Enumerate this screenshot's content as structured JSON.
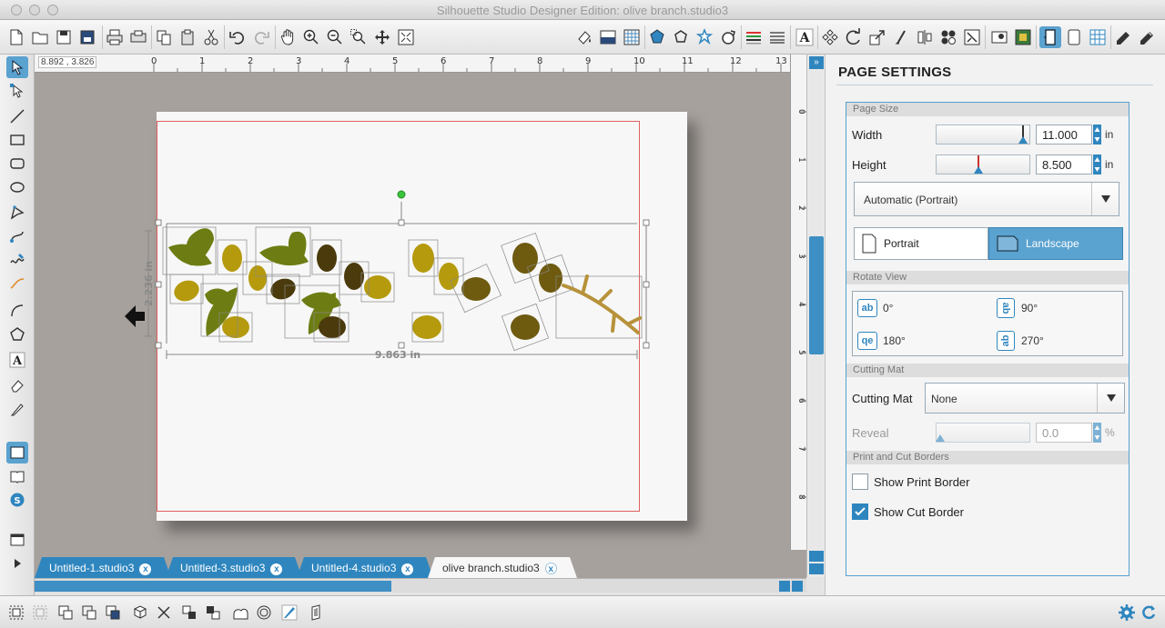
{
  "window": {
    "title": "Silhouette Studio Designer Edition: olive branch.studio3"
  },
  "canvas": {
    "coord_readout": "8.892 , 3.826",
    "ruler_top_labels": [
      "0",
      "1",
      "2",
      "3",
      "4",
      "5",
      "6",
      "7",
      "8",
      "9",
      "10",
      "11",
      "12",
      "13"
    ],
    "ruler_side_labels": [
      "0",
      "1",
      "2",
      "3",
      "4",
      "5",
      "6",
      "7",
      "8"
    ],
    "dim_width": "9.863 in",
    "dim_height": "2.236 in"
  },
  "tabs": [
    {
      "label": "Untitled-1.studio3",
      "close": "x"
    },
    {
      "label": "Untitled-3.studio3",
      "close": "x"
    },
    {
      "label": "Untitled-4.studio3",
      "close": "x"
    },
    {
      "label": "olive branch.studio3",
      "close": "x"
    }
  ],
  "panel": {
    "title": "PAGE SETTINGS",
    "page_size": {
      "header": "Page Size",
      "width_label": "Width",
      "width_value": "11.000",
      "width_unit": "in",
      "height_label": "Height",
      "height_value": "8.500",
      "height_unit": "in",
      "preset": "Automatic (Portrait)"
    },
    "orientation": {
      "portrait": "Portrait",
      "landscape": "Landscape",
      "selected": "landscape"
    },
    "rotate_view": {
      "header": "Rotate View",
      "r0": "0°",
      "r90": "90°",
      "r180": "180°",
      "r270": "270°",
      "icon0": "ab",
      "icon90": "ab",
      "icon180": "qe",
      "icon270": "ab"
    },
    "cutting_mat": {
      "header": "Cutting Mat",
      "label": "Cutting Mat",
      "value": "None",
      "reveal_label": "Reveal",
      "reveal_value": "0.0",
      "reveal_unit": "%"
    },
    "borders": {
      "header": "Print and Cut Borders",
      "show_print": "Show Print Border",
      "show_print_checked": false,
      "show_cut": "Show Cut Border",
      "show_cut_checked": true
    }
  },
  "colors": {
    "accent": "#2f86bf",
    "canvas_bg": "#a7a19d",
    "olive_green": "#6e7d13",
    "olive_yellow": "#b59a0e",
    "olive_brown": "#4a3a0c",
    "branch": "#b7923a",
    "cut_border": "#e06060"
  }
}
